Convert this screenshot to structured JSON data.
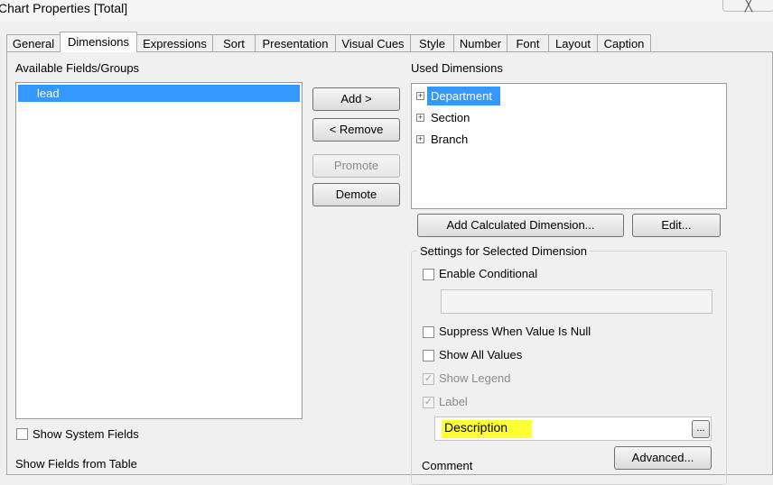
{
  "window": {
    "title": "Chart Properties [Total]",
    "close_glyph": "╳"
  },
  "tabs": [
    "General",
    "Dimensions",
    "Expressions",
    "Sort",
    "Presentation",
    "Visual Cues",
    "Style",
    "Number",
    "Font",
    "Layout",
    "Caption"
  ],
  "active_tab": "Dimensions",
  "available": {
    "label": "Available Fields/Groups",
    "items": [
      "lead"
    ],
    "selected": "lead"
  },
  "buttons": {
    "add": "Add >",
    "remove": "< Remove",
    "promote": "Promote",
    "demote": "Demote"
  },
  "used": {
    "label": "Used Dimensions",
    "items": [
      "Department",
      "Section",
      "Branch"
    ],
    "selected": "Department"
  },
  "used_buttons": {
    "add_calculated": "Add Calculated Dimension...",
    "edit": "Edit..."
  },
  "settings": {
    "title": "Settings for Selected Dimension",
    "enable_conditional": "Enable Conditional",
    "conditional_value": "",
    "suppress_null": "Suppress When Value Is Null",
    "show_all_values": "Show All Values",
    "show_legend": "Show Legend",
    "label": "Label",
    "label_value": "Description",
    "label_button": "...",
    "advanced": "Advanced...",
    "comment": "Comment"
  },
  "bottom": {
    "show_system_fields": "Show System Fields",
    "show_fields_from_table": "Show Fields from Table"
  },
  "colors": {
    "selection": "#3399ff",
    "highlight": "#ffff33"
  }
}
